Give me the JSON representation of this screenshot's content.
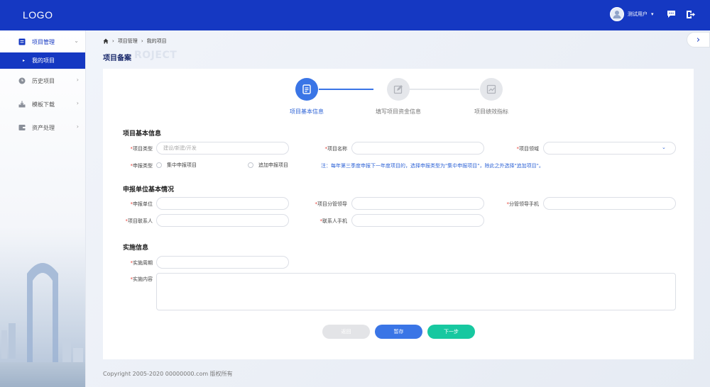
{
  "header": {
    "logo": "LOGO",
    "user_name": "测试用户",
    "icons": [
      "avatar-icon",
      "chat-icon",
      "logout-icon",
      "caret-down-icon"
    ]
  },
  "sidebar": {
    "items": [
      {
        "label": "项目管理",
        "icon": "folder-icon",
        "expanded": true
      },
      {
        "label": "历史项目",
        "icon": "clock-icon"
      },
      {
        "label": "模板下载",
        "icon": "download-icon"
      },
      {
        "label": "资产处理",
        "icon": "asset-icon"
      }
    ],
    "sub_items": [
      {
        "label": "我的项目",
        "active": true
      }
    ]
  },
  "breadcrumb": [
    "项目管理",
    "我的项目"
  ],
  "page": {
    "title": "项目备案",
    "watermark": "ROJECT"
  },
  "steps": [
    {
      "label": "项目基本信息",
      "state": "active"
    },
    {
      "label": "填写项目资金信息",
      "state": "idle"
    },
    {
      "label": "项目绩效指标",
      "state": "idle"
    }
  ],
  "form": {
    "section_basic": "项目基本信息",
    "project_type_label": "项目类型",
    "project_type_placeholder": "建设/新建/开发",
    "project_name_label": "项目名称",
    "project_field_label": "项目领域",
    "apply_type_label": "申报类型",
    "apply_type_options": [
      "集中申报项目",
      "追加申报项目"
    ],
    "note": "注：每年第三季度申报下一年度项目的，选择申报类型为\"集中申报项目\"，除此之外选择\"追加项目\"。",
    "section_unit": "申报单位基本情况",
    "apply_unit_label": "申报单位",
    "leader_label": "项目分管领导",
    "leader_phone_label": "分管领导手机",
    "contact_label": "项目联系人",
    "contact_phone_label": "联系人手机",
    "section_impl": "实施信息",
    "period_label": "实施周期",
    "content_label": "实施内容"
  },
  "buttons": {
    "back": "返回",
    "save": "暂存",
    "next": "下一步"
  },
  "footer": "Copyright 2005-2020 00000000.com 版权所有",
  "colors": {
    "primary": "#1538c2",
    "accent": "#3a75e6",
    "success": "#17c8a0",
    "required": "#e6453c"
  }
}
